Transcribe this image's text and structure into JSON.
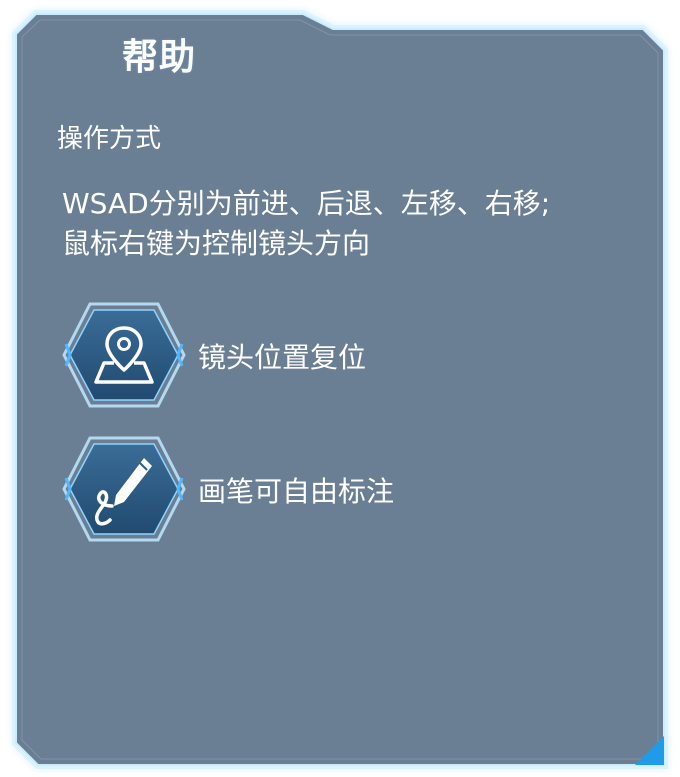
{
  "panel": {
    "title": "帮助",
    "section_heading": "操作方式",
    "instructions": [
      "WSAD分别为前进、后退、左移、右移;",
      "鼠标右键为控制镜头方向"
    ]
  },
  "features": [
    {
      "icon": "map-pin-icon",
      "label": "镜头位置复位"
    },
    {
      "icon": "pen-icon",
      "label": "画笔可自由标注"
    }
  ],
  "colors": {
    "panel_fill": "#6a7e94",
    "border_glow": "#7fd0ff",
    "accent": "#1f9bea",
    "hex_fill": "#2c5a82",
    "text": "#ffffff"
  }
}
